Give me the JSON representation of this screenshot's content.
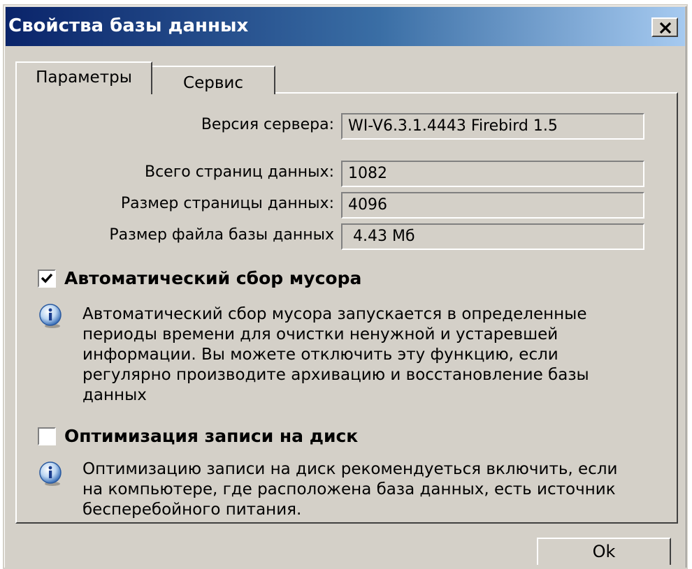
{
  "window": {
    "title": "Свойства базы данных",
    "titlebar_colors": [
      "#0a246a",
      "#3a6ea5",
      "#a6caf0"
    ],
    "face_color": "#d4d0c8"
  },
  "tabs": [
    {
      "label": "Параметры",
      "active": true
    },
    {
      "label": "Сервис",
      "active": false
    }
  ],
  "properties": {
    "server_version": {
      "label": "Версия сервера:",
      "value": "WI-V6.3.1.4443 Firebird 1.5"
    },
    "total_pages": {
      "label": "Всего страниц данных:",
      "value": "1082"
    },
    "page_size": {
      "label": "Размер страницы данных:",
      "value": "4096"
    },
    "file_size": {
      "label": "Размер файла базы данных",
      "value": " 4.43 Мб"
    }
  },
  "options": {
    "garbage_collection": {
      "label": "Автоматический сбор мусора",
      "checked": true,
      "info_icon": "info-icon",
      "info": "Автоматический сбор мусора запускается в определенные периоды времени для очистки ненужной и устаревшей информации. Вы можете отключить эту функцию, если регулярно производите архивацию и восстановление базы данных"
    },
    "disk_write": {
      "label": "Оптимизация записи на диск",
      "checked": false,
      "info_icon": "info-icon",
      "info": "Оптимизацию записи на диск рекомендуеться включить, если на компьютере, где расположена база данных, есть источник бесперебойного питания."
    }
  },
  "buttons": {
    "ok": "Ok"
  }
}
